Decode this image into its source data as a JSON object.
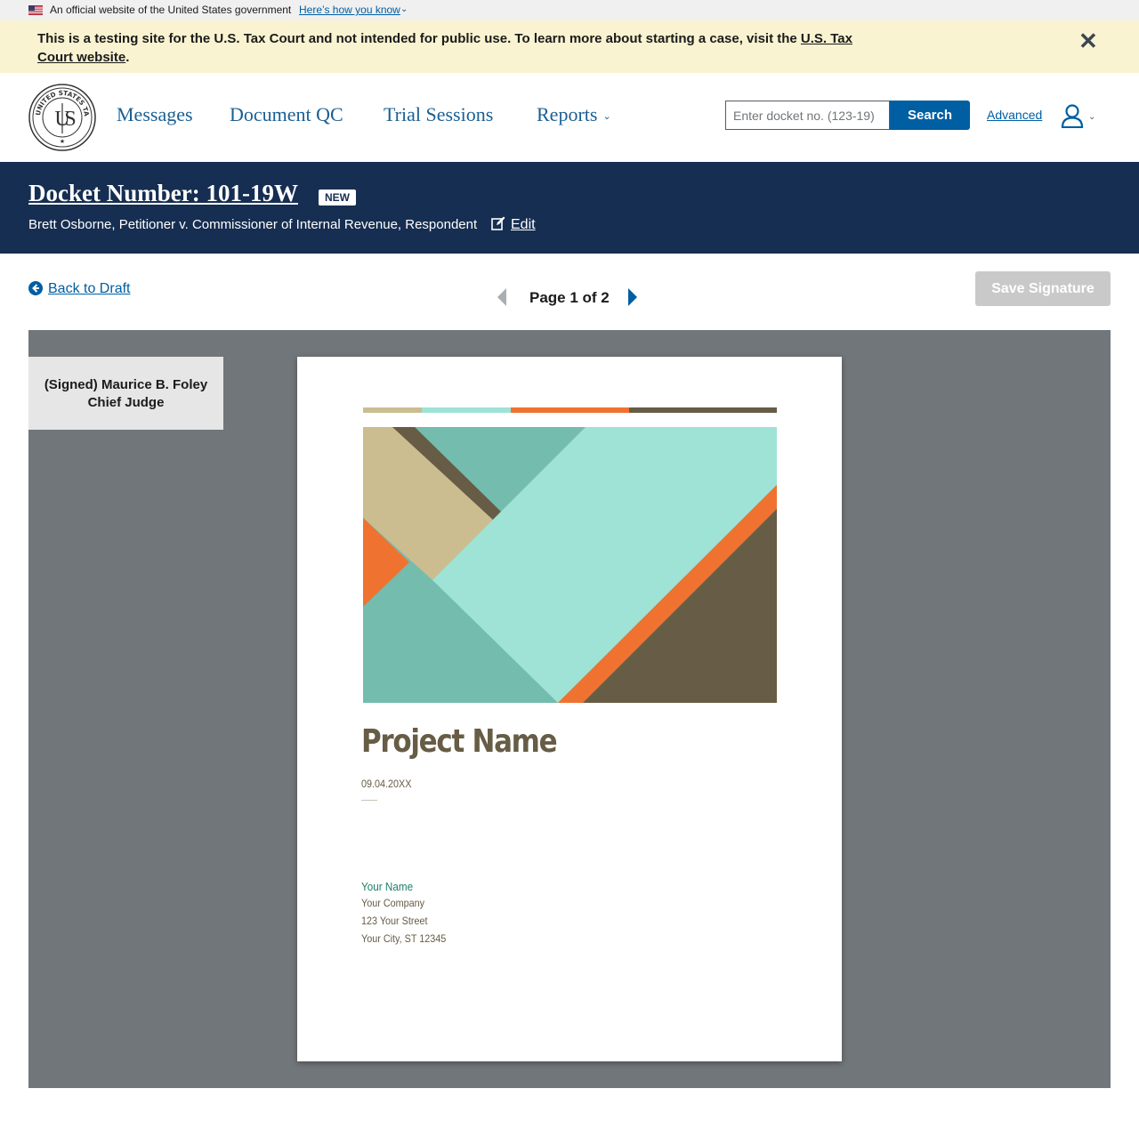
{
  "gov_banner": {
    "text": "An official website of the United States government",
    "link": "Here’s how you know"
  },
  "test_alert": {
    "text": "This is a testing site for the U.S. Tax Court and not intended for public use. To learn more about starting a case, visit the ",
    "link": "U.S. Tax Court website",
    "suffix": "."
  },
  "header": {
    "seal_text": "UNITED STATES TAX COURT",
    "nav": {
      "messages": "Messages",
      "document_qc": "Document QC",
      "trial_sessions": "Trial Sessions",
      "reports": "Reports"
    },
    "search": {
      "placeholder": "Enter docket no. (123-19)",
      "button": "Search",
      "advanced": "Advanced"
    }
  },
  "case": {
    "docket_title": "Docket Number: 101-19W",
    "status": "NEW",
    "caption": "Brett Osborne, Petitioner v. Commissioner of Internal Revenue, Respondent",
    "edit": "Edit"
  },
  "toolbar": {
    "back": "Back to Draft",
    "page_indicator": "Page 1 of 2",
    "save_signature": "Save Signature"
  },
  "signature": {
    "line1": "(Signed) Maurice B. Foley",
    "line2": "Chief Judge"
  },
  "document": {
    "project_name": "Project Name",
    "date": "09.04.20XX",
    "your_name": "Your Name",
    "company": "Your Company",
    "street": "123 Your Street",
    "city": "Your City, ST 12345"
  },
  "colors": {
    "nav_blue": "#1a5f93",
    "primary": "#005ea2",
    "banner_navy": "#162e51",
    "alert_bg": "#faf3d1",
    "pdf_gray": "#71767a",
    "doc_brown": "#675c45",
    "doc_teal": "#73bcae",
    "doc_mint": "#9fe2d6",
    "doc_orange": "#f07230",
    "doc_tan": "#cbbd8f"
  }
}
